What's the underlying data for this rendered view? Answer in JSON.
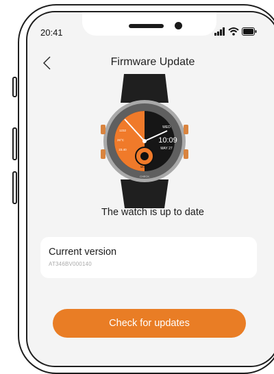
{
  "status_bar": {
    "time": "20:41",
    "icons": [
      "signal-icon",
      "wifi-icon",
      "battery-icon"
    ]
  },
  "nav": {
    "title": "Firmware Update",
    "back_icon": "chevron-left-icon"
  },
  "watch": {
    "top_time": "10:09",
    "top_day": "WED",
    "top_date": "MAY 27",
    "left_values": [
      "1232",
      "26°C",
      "23.40"
    ],
    "center_label": "MODE",
    "bottom_label": "CHECK"
  },
  "status": {
    "message": "The watch is up to date"
  },
  "version": {
    "label": "Current version",
    "value": "AT346BV000140"
  },
  "actions": {
    "check_updates": "Check for updates"
  },
  "colors": {
    "accent": "#e97d25",
    "screen_bg": "#f4f4f4",
    "card_bg": "#ffffff"
  }
}
